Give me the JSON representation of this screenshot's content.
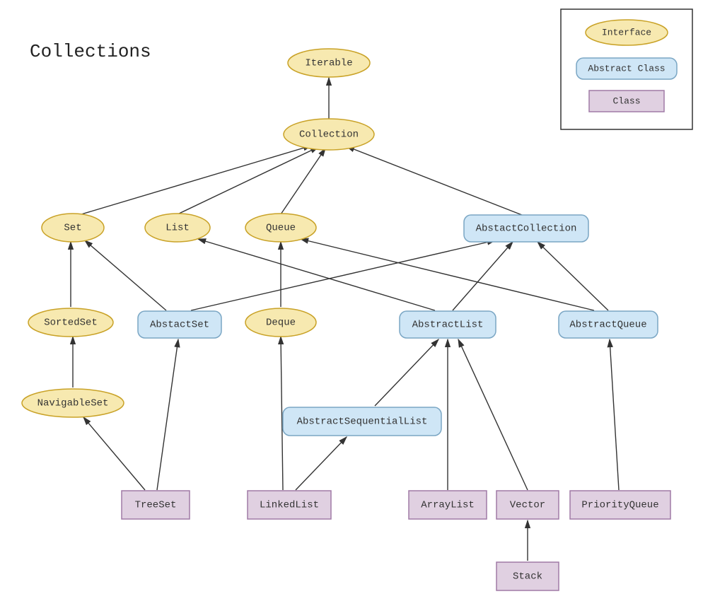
{
  "title": "Collections",
  "legend": {
    "interface": "Interface",
    "abstract": "Abstract Class",
    "class": "Class"
  },
  "nodes": {
    "iterable": "Iterable",
    "collection": "Collection",
    "set": "Set",
    "list": "List",
    "queue": "Queue",
    "abstractCollection": "AbstactCollection",
    "sortedSet": "SortedSet",
    "abstractSet": "AbstactSet",
    "deque": "Deque",
    "abstractList": "AbstractList",
    "abstractQueue": "AbstractQueue",
    "navigableSet": "NavigableSet",
    "abstractSequentialList": "AbstractSequentialList",
    "treeSet": "TreeSet",
    "linkedList": "LinkedList",
    "arrayList": "ArrayList",
    "vector": "Vector",
    "priorityQueue": "PriorityQueue",
    "stack": "Stack"
  },
  "diagram": {
    "nodeTypes": {
      "interface": "ellipse",
      "abstract": "rounded-rect",
      "class": "rect"
    },
    "edges": [
      [
        "collection",
        "iterable"
      ],
      [
        "set",
        "collection"
      ],
      [
        "list",
        "collection"
      ],
      [
        "queue",
        "collection"
      ],
      [
        "abstractCollection",
        "collection"
      ],
      [
        "sortedSet",
        "set"
      ],
      [
        "abstractSet",
        "set"
      ],
      [
        "abstractSet",
        "abstractCollection"
      ],
      [
        "deque",
        "queue"
      ],
      [
        "abstractList",
        "list"
      ],
      [
        "abstractList",
        "abstractCollection"
      ],
      [
        "abstractQueue",
        "queue"
      ],
      [
        "abstractQueue",
        "abstractCollection"
      ],
      [
        "navigableSet",
        "sortedSet"
      ],
      [
        "treeSet",
        "navigableSet"
      ],
      [
        "treeSet",
        "abstractSet"
      ],
      [
        "abstractSequentialList",
        "abstractList"
      ],
      [
        "linkedList",
        "abstractSequentialList"
      ],
      [
        "linkedList",
        "deque"
      ],
      [
        "arrayList",
        "abstractList"
      ],
      [
        "vector",
        "abstractList"
      ],
      [
        "priorityQueue",
        "abstractQueue"
      ],
      [
        "stack",
        "vector"
      ]
    ]
  }
}
